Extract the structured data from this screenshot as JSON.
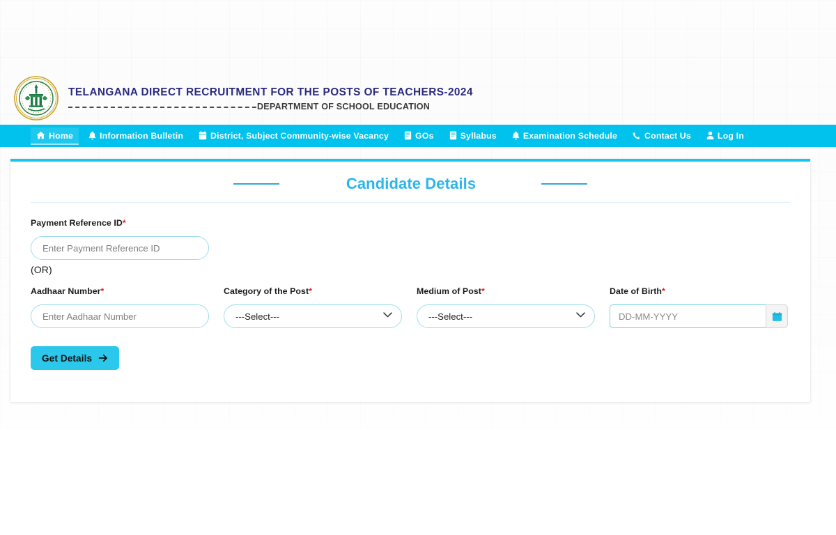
{
  "header": {
    "emblem_name": "telangana-state-emblem",
    "title": "TELANGANA DIRECT RECRUITMENT FOR THE POSTS OF TEACHERS-2024",
    "subtitle": "DEPARTMENT OF SCHOOL EDUCATION",
    "title_color": "#2b2b80"
  },
  "nav": {
    "background": "#00c2ec",
    "items": [
      {
        "label": "Home",
        "icon": "home-icon",
        "active": true
      },
      {
        "label": "Information Bulletin",
        "icon": "bell-icon",
        "active": false
      },
      {
        "label": "District, Subject Community-wise Vacancy",
        "icon": "calendar-icon",
        "active": false
      },
      {
        "label": "GOs",
        "icon": "book-icon",
        "active": false
      },
      {
        "label": "Syllabus",
        "icon": "book-icon",
        "active": false
      },
      {
        "label": "Examination Schedule",
        "icon": "bell-icon",
        "active": false
      },
      {
        "label": "Contact Us",
        "icon": "phone-icon",
        "active": false
      },
      {
        "label": "Log In",
        "icon": "user-icon",
        "active": false
      }
    ]
  },
  "card": {
    "accent_color": "#13c7f0",
    "section_title": "Candidate Details",
    "fields": {
      "payment_reference": {
        "label": "Payment Reference ID",
        "required": true,
        "placeholder": "Enter Payment Reference ID",
        "value": ""
      },
      "or_divider": "(OR)",
      "aadhaar": {
        "label": "Aadhaar Number",
        "required": true,
        "placeholder": "Enter Aadhaar Number",
        "value": ""
      },
      "category_of_post": {
        "label": "Category of the Post",
        "required": true,
        "selected": "---Select---",
        "options": [
          "---Select---"
        ]
      },
      "medium_of_post": {
        "label": "Medium of Post",
        "required": true,
        "selected": "---Select---",
        "options": [
          "---Select---"
        ]
      },
      "date_of_birth": {
        "label": "Date of Birth",
        "required": true,
        "placeholder": "DD-MM-YYYY",
        "value": "",
        "picker_icon": "calendar-icon"
      }
    },
    "submit": {
      "label": "Get Details",
      "icon": "arrow-right-icon",
      "background": "#2bc8ec"
    }
  }
}
